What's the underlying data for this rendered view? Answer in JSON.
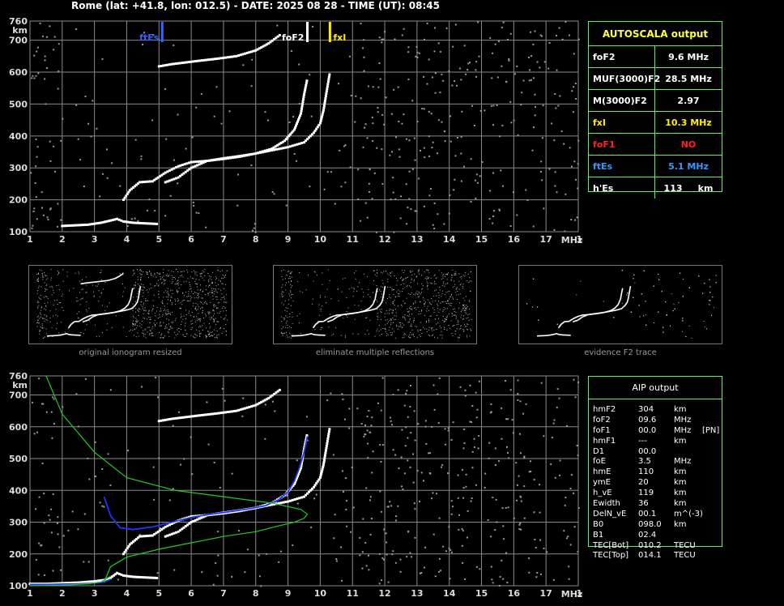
{
  "header": {
    "title": "Rome (lat: +41.8, lon: 012.5) - DATE: 2025 08 28 - TIME (UT): 08:45"
  },
  "colors": {
    "grid": "#8a8a8a",
    "trace": "#ffffff",
    "ftEs": "#3366ff",
    "foF2": "#ffffff",
    "fxI": "#ffee00",
    "foF1": "#ff2222",
    "panel_border": "#66ee66",
    "profile_blue": "#2233ff",
    "profile_green": "#22cc22"
  },
  "autoscala": {
    "title": "AUTOSCALA output",
    "rows": [
      {
        "label": "foF2",
        "value": "9.6 MHz",
        "color": "#ffffff"
      },
      {
        "label": "MUF(3000)F2",
        "value": "28.5 MHz",
        "color": "#ffffff"
      },
      {
        "label": "M(3000)F2",
        "value": "2.97",
        "color": "#ffffff"
      },
      {
        "label": "fxI",
        "value": "10.3 MHz",
        "color": "#ffee00"
      },
      {
        "label": "foF1",
        "value": "NO",
        "color": "#ff2222"
      },
      {
        "label": "ftEs",
        "value": "5.1 MHz",
        "color": "#3399ff"
      },
      {
        "label": "h'Es",
        "value": "113     km",
        "color": "#ffffff"
      }
    ]
  },
  "aip": {
    "title": "AIP output",
    "rows": [
      [
        "hmF2",
        "304",
        "km",
        ""
      ],
      [
        "foF2",
        "09.6",
        "MHz",
        ""
      ],
      [
        "foF1",
        "00.0",
        "MHz",
        "[PN]"
      ],
      [
        "hmF1",
        "---",
        "km",
        ""
      ],
      [
        "D1",
        "00.0",
        "",
        ""
      ],
      [
        "foE",
        "3.5",
        "MHz",
        ""
      ],
      [
        "hmE",
        "110",
        "km",
        ""
      ],
      [
        "ymE",
        "20",
        "km",
        ""
      ],
      [
        "h_vE",
        "119",
        "km",
        ""
      ],
      [
        "Ewidth",
        "36",
        "km",
        ""
      ],
      [
        "DelN_vE",
        "00.1",
        "m^(-3)",
        ""
      ],
      [
        "B0",
        "098.0",
        "km",
        ""
      ],
      [
        "B1",
        "02.4",
        "",
        ""
      ],
      [
        "TEC[Bot]",
        "010.2",
        "TECU",
        ""
      ],
      [
        "TEC[Top]",
        "014.1",
        "TECU",
        ""
      ]
    ]
  },
  "thumbnails": {
    "captions": [
      "original ionogram resized",
      "eliminate multiple reflections",
      "evidence F2 trace"
    ]
  },
  "chart_data": [
    {
      "type": "scatter",
      "name_ref": "autoscala-ionogram",
      "xlabel": "MHz",
      "ylabel": "km",
      "xlim": [
        1,
        18
      ],
      "ylim": [
        100,
        760
      ],
      "x_ticks": [
        1,
        2,
        3,
        4,
        5,
        6,
        7,
        8,
        9,
        10,
        11,
        12,
        13,
        14,
        15,
        16,
        17,
        18
      ],
      "y_ticks": [
        100,
        200,
        300,
        400,
        500,
        600,
        700,
        760
      ],
      "grid": true,
      "markers": [
        {
          "label": "ftEs",
          "x": 5.1,
          "color": "#3366ff"
        },
        {
          "label": "foF2",
          "x": 9.6,
          "color": "#ffffff"
        },
        {
          "label": "fxI",
          "x": 10.3,
          "color": "#ffee00"
        }
      ],
      "series": [
        {
          "role": "Es-trace",
          "x": [
            2.0,
            2.4,
            2.8,
            3.2,
            3.5,
            3.7,
            3.9,
            4.2,
            4.6,
            5.0
          ],
          "y": [
            118,
            120,
            122,
            128,
            135,
            140,
            132,
            128,
            126,
            124
          ]
        },
        {
          "role": "F-trace-o",
          "x": [
            3.9,
            4.1,
            4.4,
            4.8,
            5.2,
            5.6,
            6.0,
            6.5,
            7.0,
            7.5,
            8.0,
            8.5,
            8.9,
            9.2,
            9.4,
            9.5,
            9.6
          ],
          "y": [
            200,
            230,
            255,
            258,
            285,
            305,
            318,
            322,
            328,
            335,
            345,
            360,
            385,
            420,
            470,
            530,
            580
          ]
        },
        {
          "role": "F-trace-x",
          "x": [
            5.2,
            5.6,
            6.0,
            6.5,
            7.0,
            7.5,
            8.0,
            8.5,
            9.0,
            9.5,
            9.8,
            10.0,
            10.1,
            10.2,
            10.3
          ],
          "y": [
            255,
            270,
            300,
            322,
            330,
            337,
            345,
            355,
            365,
            380,
            410,
            440,
            480,
            540,
            600
          ]
        },
        {
          "role": "multiple-reflection",
          "x": [
            5.0,
            5.4,
            5.8,
            6.2,
            6.8,
            7.4,
            8.0,
            8.4,
            8.8
          ],
          "y": [
            618,
            625,
            630,
            635,
            642,
            650,
            668,
            690,
            720
          ]
        }
      ]
    },
    {
      "type": "line",
      "name_ref": "aip-ionogram",
      "xlabel": "MHz",
      "ylabel": "km",
      "xlim": [
        1,
        18
      ],
      "ylim": [
        100,
        760
      ],
      "x_ticks": [
        1,
        2,
        3,
        4,
        5,
        6,
        7,
        8,
        9,
        10,
        11,
        12,
        13,
        14,
        15,
        16,
        17,
        18
      ],
      "y_ticks": [
        100,
        200,
        300,
        400,
        500,
        600,
        700,
        760
      ],
      "grid": true,
      "series": [
        {
          "role": "trace-o",
          "x": [
            3.9,
            4.1,
            4.4,
            4.8,
            5.2,
            5.6,
            6.0,
            6.5,
            7.0,
            7.5,
            8.0,
            8.5,
            8.9,
            9.2,
            9.4,
            9.5,
            9.6
          ],
          "y": [
            200,
            230,
            255,
            258,
            285,
            305,
            318,
            322,
            328,
            335,
            345,
            360,
            385,
            420,
            470,
            530,
            580
          ]
        },
        {
          "role": "trace-x",
          "x": [
            5.2,
            5.6,
            6.0,
            6.5,
            7.0,
            7.5,
            8.0,
            8.5,
            9.0,
            9.5,
            9.8,
            10.0,
            10.1,
            10.2,
            10.3
          ],
          "y": [
            255,
            270,
            300,
            322,
            330,
            337,
            345,
            355,
            365,
            380,
            410,
            440,
            480,
            540,
            600
          ]
        },
        {
          "role": "Es-trace",
          "x": [
            1.0,
            1.5,
            2.0,
            2.5,
            3.0,
            3.3,
            3.5,
            3.7,
            3.9,
            4.2,
            4.6,
            5.0
          ],
          "y": [
            106,
            106,
            108,
            110,
            114,
            118,
            125,
            140,
            132,
            128,
            126,
            124
          ]
        },
        {
          "role": "multiple-reflection",
          "x": [
            5.0,
            5.4,
            5.8,
            6.2,
            6.8,
            7.4,
            8.0,
            8.4,
            8.8
          ],
          "y": [
            618,
            625,
            630,
            635,
            642,
            650,
            668,
            690,
            720
          ]
        },
        {
          "role": "virtual-height-fit",
          "color": "#2233ff",
          "x": [
            3.3,
            3.5,
            3.8,
            4.2,
            4.8,
            5.4,
            6.0,
            6.6,
            7.2,
            7.8,
            8.3,
            8.7,
            9.0,
            9.2,
            9.35,
            9.5,
            9.6
          ],
          "y": [
            380,
            320,
            282,
            277,
            285,
            300,
            315,
            325,
            333,
            342,
            352,
            370,
            395,
            430,
            470,
            520,
            570
          ]
        },
        {
          "role": "E-fit",
          "color": "#2233ff",
          "x": [
            1.0,
            1.5,
            2.0,
            2.5,
            3.0,
            3.3,
            3.5
          ],
          "y": [
            104,
            104,
            105,
            106,
            108,
            112,
            120
          ]
        },
        {
          "role": "real-height-profile",
          "color": "#22cc22",
          "x": [
            3.3,
            3.5,
            4.0,
            5.0,
            6.0,
            7.0,
            8.0,
            8.7,
            9.2,
            9.5,
            9.6,
            9.4,
            8.5,
            7.0,
            5.5,
            4.0,
            3.0,
            2.0,
            1.5
          ],
          "y": [
            112,
            160,
            190,
            215,
            235,
            255,
            270,
            288,
            300,
            312,
            325,
            340,
            360,
            380,
            400,
            440,
            520,
            640,
            760
          ]
        },
        {
          "role": "E-profile",
          "color": "#22cc22",
          "x": [
            1.0,
            2.0,
            2.8,
            3.2,
            3.5
          ],
          "y": [
            100,
            102,
            106,
            112,
            130
          ]
        }
      ]
    }
  ]
}
